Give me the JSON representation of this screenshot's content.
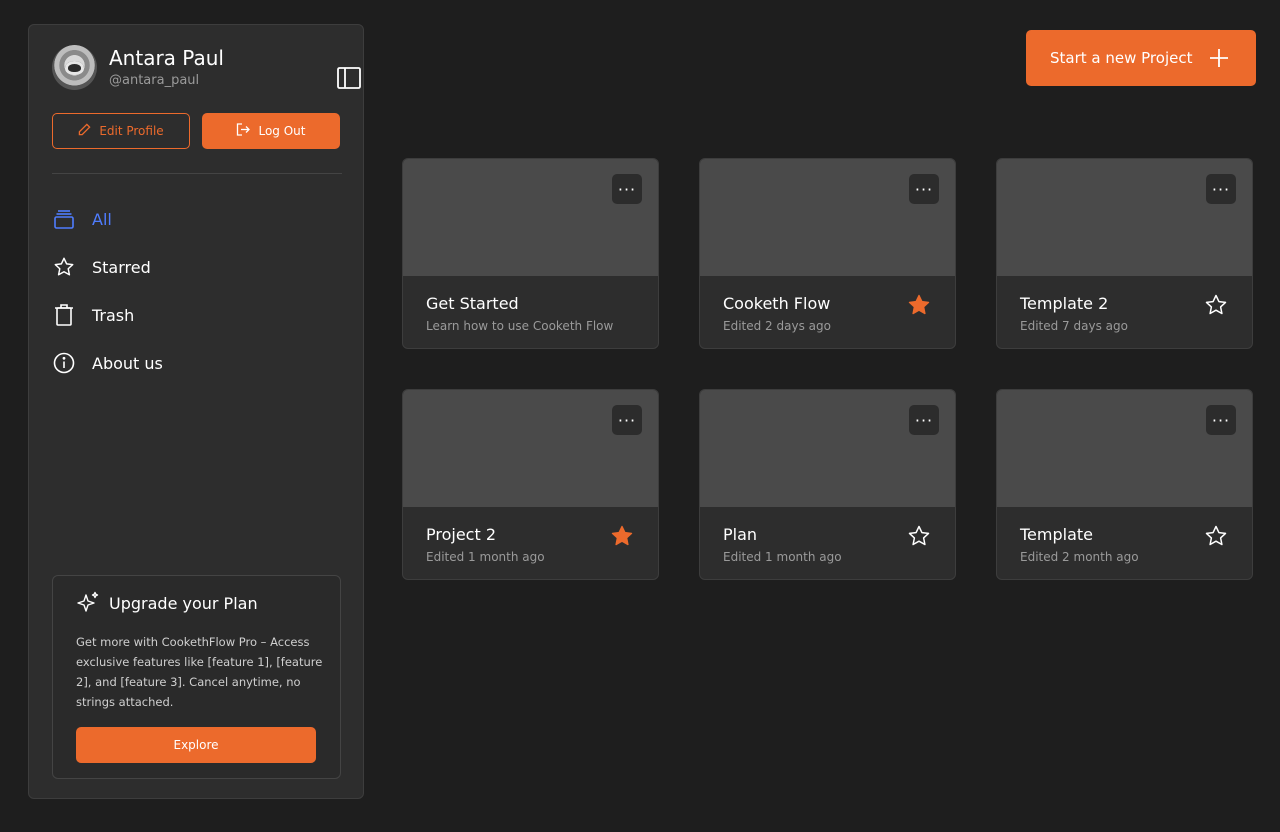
{
  "user": {
    "name": "Antara Paul",
    "handle": "@antara_paul"
  },
  "actions": {
    "edit_profile": "Edit Profile",
    "log_out": "Log Out",
    "new_project": "Start a new Project"
  },
  "nav": [
    {
      "label": "All",
      "icon": "stack-icon",
      "active": true
    },
    {
      "label": "Starred",
      "icon": "star-icon",
      "active": false
    },
    {
      "label": "Trash",
      "icon": "trash-icon",
      "active": false
    },
    {
      "label": "About us",
      "icon": "info-icon",
      "active": false
    }
  ],
  "upgrade": {
    "title": "Upgrade your Plan",
    "text": "Get more with CookethFlow Pro – Access exclusive features like [feature 1], [feature 2], and [feature 3]. Cancel anytime, no strings attached.",
    "button": "Explore"
  },
  "projects": [
    {
      "title": "Get Started",
      "subtitle": "Learn how to use Cooketh Flow",
      "starred": null
    },
    {
      "title": "Cooketh Flow",
      "subtitle": "Edited 2 days ago",
      "starred": true
    },
    {
      "title": "Template 2",
      "subtitle": "Edited 7 days ago",
      "starred": false
    },
    {
      "title": "Project 2",
      "subtitle": "Edited 1 month ago",
      "starred": true
    },
    {
      "title": "Plan",
      "subtitle": "Edited 1 month ago",
      "starred": false
    },
    {
      "title": "Template",
      "subtitle": "Edited 2 month ago",
      "starred": false
    }
  ],
  "colors": {
    "accent": "#ec6a2c",
    "active_nav": "#4f7dff",
    "background": "#1e1e1e",
    "panel": "#2d2d2d"
  }
}
